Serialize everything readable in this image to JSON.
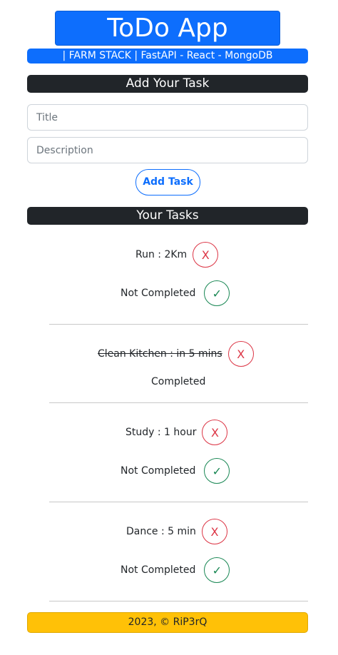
{
  "header": {
    "title": "ToDo App",
    "subtitle": "| FARM STACK | FastAPI - React - MongoDB"
  },
  "add_section": {
    "heading": "Add Your Task",
    "title_placeholder": "Title",
    "description_placeholder": "Description",
    "button_label": "Add Task"
  },
  "tasks_section": {
    "heading": "Your Tasks",
    "tasks": [
      {
        "text": "Run : 2Km",
        "status": "Not Completed",
        "completed": false,
        "delete_label": "X",
        "complete_label": "✓"
      },
      {
        "text": "Clean Kitchen : in 5 mins",
        "status": "Completed",
        "completed": true,
        "delete_label": "X"
      },
      {
        "text": "Study : 1 hour",
        "status": "Not Completed",
        "completed": false,
        "delete_label": "X",
        "complete_label": "✓"
      },
      {
        "text": "Dance : 5 min",
        "status": "Not Completed",
        "completed": false,
        "delete_label": "X",
        "complete_label": "✓"
      }
    ]
  },
  "footer": {
    "text": "2023, © RiP3rQ"
  },
  "colors": {
    "primary": "#0d6efd",
    "dark": "#212529",
    "danger": "#dc3545",
    "success": "#198754",
    "warning": "#ffc107"
  }
}
